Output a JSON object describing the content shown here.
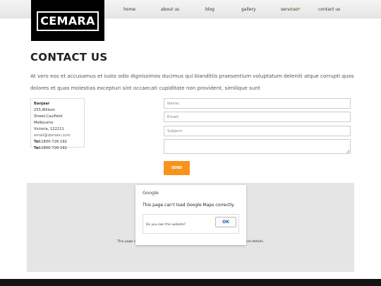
{
  "brand": {
    "logo_text": "CEMARA"
  },
  "nav": {
    "items": [
      {
        "label": "home"
      },
      {
        "label": "about us"
      },
      {
        "label": "blog"
      },
      {
        "label": "gallery"
      },
      {
        "label": "services"
      },
      {
        "label": "contact us"
      }
    ]
  },
  "page": {
    "title": "CONTACT US",
    "intro": "At vero eos et accusamus et iusto odio dignissimos ducimus qui blanditiis praesentium voluptatum deleniti atque corrupti quos dolores et quas molestias excepturi sint occaecati cupiditate non provident, similique sunt"
  },
  "address": {
    "name": "Banjaar",
    "street": "255,Willson Street,Caulfield",
    "city": "Melbourne",
    "region": "Victoria, 122211",
    "email": "email@domain.com",
    "tel_label": "Tel:",
    "tel1": "1800-726-192",
    "tel2": "1800-726-192"
  },
  "form": {
    "name_placeholder": "Name:",
    "email_placeholder": "Email:",
    "subject_placeholder": "Subject:",
    "send_label": "SEND"
  },
  "map": {
    "google_label": "Google",
    "error_message": "This page can't load Google Maps correctly.",
    "owner_question": "Do you own this website?",
    "ok_label": "OK",
    "bg_text_left": "This page c",
    "bg_text_right": "ical details."
  },
  "colors": {
    "accent": "#f7941d",
    "footer": "#141414",
    "map_bg": "#e5e5e5"
  }
}
